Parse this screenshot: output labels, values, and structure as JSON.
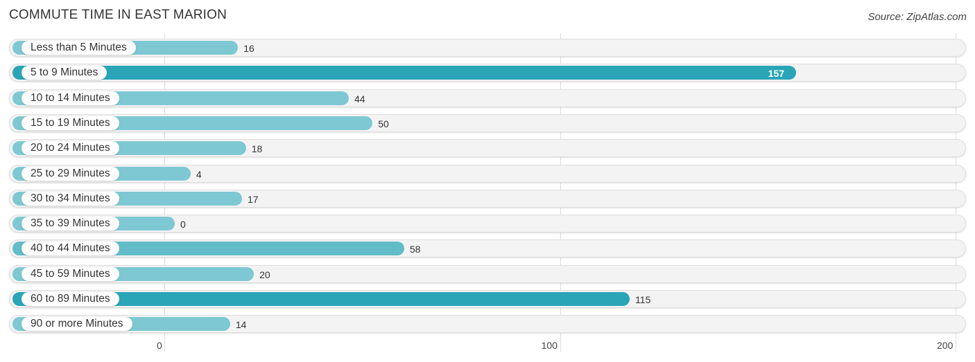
{
  "header": {
    "title": "COMMUTE TIME IN EAST MARION",
    "source": "Source: ZipAtlas.com"
  },
  "chart_data": {
    "type": "bar",
    "orientation": "horizontal",
    "title": "COMMUTE TIME IN EAST MARION",
    "xlabel": "",
    "ylabel": "",
    "xlim": [
      0,
      200
    ],
    "ticks": [
      0,
      100,
      200
    ],
    "tick_labels": [
      "0",
      "100",
      "200"
    ],
    "grid": true,
    "categories": [
      "Less than 5 Minutes",
      "5 to 9 Minutes",
      "10 to 14 Minutes",
      "15 to 19 Minutes",
      "20 to 24 Minutes",
      "25 to 29 Minutes",
      "30 to 34 Minutes",
      "35 to 39 Minutes",
      "40 to 44 Minutes",
      "45 to 59 Minutes",
      "60 to 89 Minutes",
      "90 or more Minutes"
    ],
    "values": [
      16,
      157,
      44,
      50,
      18,
      4,
      17,
      0,
      58,
      20,
      115,
      14
    ],
    "colors": {
      "highlight": "#2aa5b8",
      "normal": "#7ec8d3",
      "mid": "#62bcc8"
    }
  }
}
